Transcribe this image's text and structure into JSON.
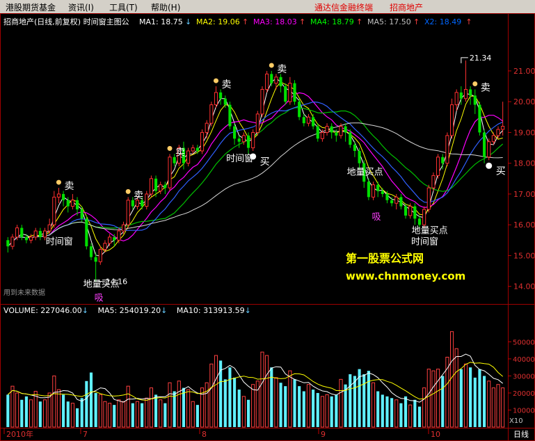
{
  "menu": {
    "items": [
      "港股期货基金",
      "资讯(I)",
      "工具(T)",
      "帮助(H)"
    ],
    "links": [
      "通达信金融终端",
      "招商地产"
    ]
  },
  "header": {
    "title": "招商地产(日线,前复权) 时间窗主图公",
    "ma_items": [
      {
        "label": "MA1: 18.75",
        "arrow": "↓",
        "color": "#ffffff",
        "arrow_color": "#66ccff"
      },
      {
        "label": "MA2: 19.06",
        "arrow": "↑",
        "color": "#ffff00",
        "arrow_color": "#ff4040"
      },
      {
        "label": "MA3: 18.03",
        "arrow": "↑",
        "color": "#ff00ff",
        "arrow_color": "#ff4040"
      },
      {
        "label": "MA4: 18.79",
        "arrow": "↑",
        "color": "#00ff00",
        "arrow_color": "#ff4040"
      },
      {
        "label": "MA5: 17.50",
        "arrow": "↑",
        "color": "#c0c0c0",
        "arrow_color": "#ff4040"
      },
      {
        "label": "X2: 18.49",
        "arrow": "↑",
        "color": "#0066ff",
        "arrow_color": "#ff4040"
      }
    ]
  },
  "volume_header": {
    "volume": "VOLUME: 227046.00",
    "ma5": "MA5: 254019.20",
    "ma10": "MA10: 313913.59",
    "arrow": "↓"
  },
  "watermark": {
    "line1": "第一股票公式网",
    "line2": "www.chnmoney.com"
  },
  "footer_note": "用到未来数据",
  "x_axis": {
    "labels": [
      "2010年",
      "7",
      "8",
      "9",
      "10"
    ],
    "right": "日线",
    "scale_label": "X10"
  },
  "colors": {
    "up": "#ff3030",
    "down": "#00e000",
    "neutral": "#ffffff",
    "volume_up": "#ff4040",
    "volume_down": "#60f0ff",
    "gold_candle": "#ffd030",
    "blue_candle": "#3090ff"
  },
  "chart_data": {
    "type": "candlestick",
    "price_axis": {
      "ticks": [
        14.0,
        15.0,
        16.0,
        17.0,
        18.0,
        19.0,
        20.0,
        21.0
      ],
      "ylim": [
        13.45,
        22.4
      ]
    },
    "volume_axis": {
      "ticks": [
        10000,
        20000,
        30000,
        40000,
        50000
      ],
      "ylim": [
        0,
        62000
      ],
      "unit_label": "X10"
    },
    "candles": [
      [
        15.5,
        15.3,
        15.6,
        15.1
      ],
      [
        15.3,
        15.6,
        15.7,
        15.2
      ],
      [
        15.6,
        15.9,
        16.0,
        15.5
      ],
      [
        15.9,
        15.6,
        16.0,
        15.5
      ],
      [
        15.6,
        15.5,
        15.7,
        15.4
      ],
      [
        15.5,
        15.6,
        15.7,
        15.4
      ],
      [
        15.6,
        15.8,
        15.9,
        15.5
      ],
      [
        15.8,
        15.6,
        15.9,
        15.5
      ],
      [
        15.6,
        15.8,
        15.9,
        15.5
      ],
      [
        15.8,
        16.0,
        16.2,
        15.7
      ],
      [
        16.0,
        16.9,
        17.1,
        15.9
      ],
      [
        16.9,
        17.0,
        17.2,
        16.7
      ],
      [
        17.0,
        16.8,
        17.1,
        16.6
      ],
      [
        16.8,
        16.6,
        16.9,
        16.4
      ],
      [
        16.6,
        16.8,
        17.0,
        16.5
      ],
      [
        16.8,
        16.5,
        16.9,
        16.3
      ],
      [
        16.5,
        16.2,
        16.6,
        16.1
      ],
      [
        16.2,
        15.3,
        16.3,
        15.2
      ],
      [
        15.3,
        14.95,
        15.4,
        14.85
      ],
      [
        14.95,
        14.8,
        15.1,
        14.16
      ],
      [
        14.8,
        15.2,
        15.3,
        14.7
      ],
      [
        15.2,
        15.4,
        15.5,
        15.1
      ],
      [
        15.4,
        15.6,
        15.7,
        15.3
      ],
      [
        15.6,
        15.5,
        15.7,
        15.3
      ],
      [
        15.5,
        15.8,
        15.9,
        15.4
      ],
      [
        15.8,
        16.0,
        16.1,
        15.7
      ],
      [
        16.0,
        16.8,
        16.9,
        15.9
      ],
      [
        16.8,
        16.6,
        16.9,
        16.5
      ],
      [
        16.6,
        16.8,
        16.9,
        16.5
      ],
      [
        16.8,
        16.6,
        16.9,
        16.5
      ],
      [
        16.6,
        17.0,
        17.1,
        16.5
      ],
      [
        17.0,
        17.5,
        17.6,
        16.9
      ],
      [
        17.5,
        17.1,
        17.6,
        16.9
      ],
      [
        17.1,
        17.3,
        17.4,
        17.0
      ],
      [
        17.3,
        17.2,
        17.4,
        17.0
      ],
      [
        17.2,
        18.2,
        18.3,
        17.1
      ],
      [
        18.2,
        18.0,
        18.3,
        17.9
      ],
      [
        18.0,
        18.5,
        18.6,
        17.9
      ],
      [
        18.5,
        18.0,
        18.7,
        17.8
      ],
      [
        18.0,
        18.4,
        18.5,
        17.9
      ],
      [
        18.4,
        18.5,
        18.6,
        18.3
      ],
      [
        18.5,
        18.4,
        18.6,
        18.3
      ],
      [
        18.4,
        19.0,
        19.1,
        18.3
      ],
      [
        19.0,
        19.3,
        19.4,
        18.8
      ],
      [
        19.3,
        19.9,
        20.0,
        19.2
      ],
      [
        19.9,
        20.3,
        20.5,
        19.8
      ],
      [
        20.3,
        20.1,
        20.4,
        19.9
      ],
      [
        20.1,
        19.9,
        20.2,
        19.8
      ],
      [
        19.9,
        19.2,
        20.0,
        19.1
      ],
      [
        19.2,
        18.8,
        19.3,
        18.6
      ],
      [
        18.8,
        18.7,
        18.9,
        18.5
      ],
      [
        18.7,
        18.9,
        19.0,
        18.6
      ],
      [
        18.9,
        18.5,
        19.0,
        18.3
      ],
      [
        18.5,
        19.0,
        19.1,
        18.4
      ],
      [
        19.0,
        19.6,
        19.7,
        18.9
      ],
      [
        19.6,
        20.4,
        20.5,
        19.5
      ],
      [
        20.4,
        20.9,
        21.0,
        20.3
      ],
      [
        20.9,
        20.6,
        21.0,
        20.5
      ],
      [
        20.6,
        20.8,
        20.9,
        20.4
      ],
      [
        20.8,
        20.5,
        20.9,
        20.3
      ],
      [
        20.5,
        20.0,
        20.6,
        19.9
      ],
      [
        20.0,
        20.6,
        20.8,
        19.9
      ],
      [
        20.6,
        20.0,
        20.7,
        19.9
      ],
      [
        20.0,
        19.5,
        20.1,
        19.4
      ],
      [
        19.5,
        19.3,
        19.6,
        19.2
      ],
      [
        19.3,
        19.5,
        19.6,
        19.2
      ],
      [
        19.5,
        19.2,
        19.6,
        19.1
      ],
      [
        19.2,
        18.8,
        19.3,
        18.7
      ],
      [
        18.8,
        19.0,
        19.1,
        18.7
      ],
      [
        19.0,
        19.2,
        19.3,
        18.9
      ],
      [
        19.2,
        19.0,
        19.3,
        18.8
      ],
      [
        19.0,
        18.9,
        19.1,
        18.7
      ],
      [
        18.9,
        19.2,
        19.3,
        18.8
      ],
      [
        19.2,
        19.0,
        19.3,
        18.7
      ],
      [
        19.0,
        18.6,
        19.1,
        18.5
      ],
      [
        18.6,
        18.4,
        18.7,
        18.2
      ],
      [
        18.4,
        18.0,
        18.5,
        17.8
      ],
      [
        18.0,
        17.4,
        18.1,
        17.2
      ],
      [
        17.4,
        16.9,
        17.5,
        16.8
      ],
      [
        16.9,
        17.3,
        17.4,
        16.8
      ],
      [
        17.3,
        17.1,
        17.4,
        16.9
      ],
      [
        17.1,
        17.0,
        17.2,
        16.9
      ],
      [
        17.0,
        16.8,
        17.1,
        16.7
      ],
      [
        16.8,
        16.7,
        16.9,
        16.6
      ],
      [
        16.7,
        16.9,
        17.0,
        16.5
      ],
      [
        16.9,
        16.6,
        17.0,
        16.5
      ],
      [
        16.6,
        16.3,
        16.7,
        16.2
      ],
      [
        16.3,
        16.6,
        16.7,
        16.2
      ],
      [
        16.6,
        16.2,
        16.7,
        16.0
      ],
      [
        16.2,
        16.0,
        16.3,
        15.9
      ],
      [
        16.0,
        16.5,
        16.6,
        15.9
      ],
      [
        16.5,
        17.2,
        17.3,
        16.4
      ],
      [
        17.2,
        17.6,
        17.7,
        17.1
      ],
      [
        17.6,
        18.2,
        18.3,
        17.5
      ],
      [
        18.2,
        18.0,
        18.3,
        17.8
      ],
      [
        18.0,
        18.9,
        19.0,
        17.9
      ],
      [
        18.9,
        19.9,
        20.1,
        18.8
      ],
      [
        19.9,
        20.3,
        20.4,
        19.7
      ],
      [
        20.3,
        20.1,
        20.5,
        19.9
      ],
      [
        20.1,
        20.4,
        21.34,
        20.0
      ],
      [
        20.4,
        20.2,
        20.5,
        19.9
      ],
      [
        20.2,
        19.9,
        20.4,
        19.6
      ],
      [
        19.9,
        19.0,
        20.0,
        18.9
      ],
      [
        19.0,
        18.2,
        19.1,
        18.0
      ],
      [
        18.2,
        18.7,
        18.8,
        18.1
      ],
      [
        18.7,
        18.9,
        19.0,
        18.6
      ],
      [
        18.9,
        19.1,
        19.2,
        18.8
      ],
      [
        19.1,
        19.2,
        20.0,
        18.9
      ]
    ],
    "volumes": [
      19000,
      24000,
      20000,
      16000,
      18000,
      16000,
      21000,
      15000,
      16000,
      20000,
      30000,
      22000,
      19000,
      15000,
      14000,
      11000,
      17000,
      27000,
      32000,
      20000,
      19000,
      15000,
      14000,
      13000,
      16000,
      15000,
      24000,
      14000,
      15000,
      14000,
      17000,
      23000,
      19000,
      16000,
      14000,
      26000,
      21000,
      27000,
      23000,
      22000,
      15000,
      13000,
      23000,
      26000,
      37000,
      42000,
      39000,
      28000,
      35000,
      29000,
      22000,
      18000,
      16000,
      25000,
      27000,
      44000,
      42000,
      35000,
      29000,
      26000,
      24000,
      33000,
      28000,
      24000,
      21000,
      25000,
      22000,
      20000,
      18000,
      19000,
      18000,
      19000,
      28000,
      25000,
      31000,
      30000,
      34000,
      31000,
      33000,
      26000,
      21000,
      19000,
      18000,
      17000,
      16000,
      14000,
      18000,
      13000,
      16000,
      12000,
      23000,
      34000,
      33000,
      34000,
      30000,
      41000,
      56000,
      46000,
      34000,
      37000,
      35000,
      29000,
      34000,
      30000,
      27000,
      23000,
      25000,
      23000
    ],
    "labels": {
      "sell": "卖",
      "buy": "买",
      "time_window": "时间窗",
      "ground_buy": "地量买点",
      "absorb": "吸",
      "low_price": "14.16",
      "high_price": "21.34"
    },
    "sell_markers": [
      11,
      26,
      35,
      45,
      57,
      101
    ],
    "buy_markers": [
      53,
      104
    ],
    "time_window_markers": [
      10,
      49,
      89
    ],
    "ground_buy_markers": [
      19,
      76,
      90
    ],
    "absorb_markers": [
      19,
      79
    ],
    "annotations": [
      {
        "text": "14.16",
        "index": 19,
        "price": 14.16
      },
      {
        "text": "21.34",
        "index": 98,
        "price": 21.34
      }
    ]
  }
}
